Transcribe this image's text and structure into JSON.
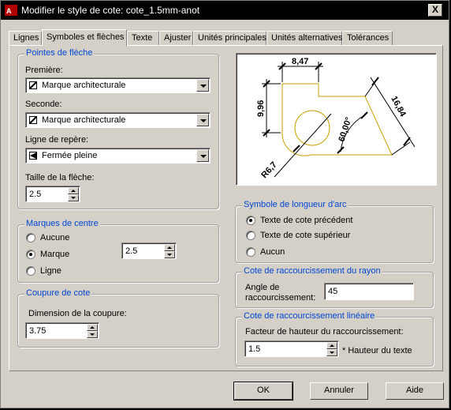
{
  "window": {
    "title": "Modifier le style de cote: cote_1.5mm-anot",
    "close_glyph": "X"
  },
  "tabs": [
    "Lignes",
    "Symboles et flèches",
    "Texte",
    "Ajuster",
    "Unités principales",
    "Unités alternatives",
    "Tolérances"
  ],
  "arrowheads": {
    "title": "Pointes de flèche",
    "first_label": "Première:",
    "first_value": "Marque architecturale",
    "second_label": "Seconde:",
    "second_value": "Marque architecturale",
    "leader_label": "Ligne de repère:",
    "leader_value": "Fermée pleine",
    "size_label": "Taille de la flèche:",
    "size_value": "2.5"
  },
  "center_marks": {
    "title": "Marques de centre",
    "options": [
      "Aucune",
      "Marque",
      "Ligne"
    ],
    "selected": "Marque",
    "size_value": "2.5"
  },
  "dim_break": {
    "title": "Coupure de cote",
    "size_label": "Dimension de la coupure:",
    "size_value": "3.75"
  },
  "preview": {
    "labels": [
      "8,47",
      "9,96",
      "16,84",
      "60,00°",
      "R6,7"
    ],
    "line_color": "#c8a000"
  },
  "arc_length": {
    "title": "Symbole de longueur d'arc",
    "options": [
      "Texte de cote précédent",
      "Texte de cote supérieur",
      "Aucun"
    ],
    "selected": "Texte de cote précédent"
  },
  "radius_jog": {
    "title": "Cote de raccourcissement du rayon",
    "angle_label_1": "Angle de",
    "angle_label_2": "raccourcissement:",
    "angle_value": "45"
  },
  "linear_jog": {
    "title": "Cote de raccourcissement linéaire",
    "factor_label": "Facteur de hauteur du raccourcissement:",
    "factor_value": "1.5",
    "factor_suffix": "* Hauteur du texte"
  },
  "buttons": {
    "ok": "OK",
    "cancel": "Annuler",
    "help": "Aide"
  },
  "colors": {
    "group_title": "#0046d5",
    "face": "#d4d0c8"
  }
}
